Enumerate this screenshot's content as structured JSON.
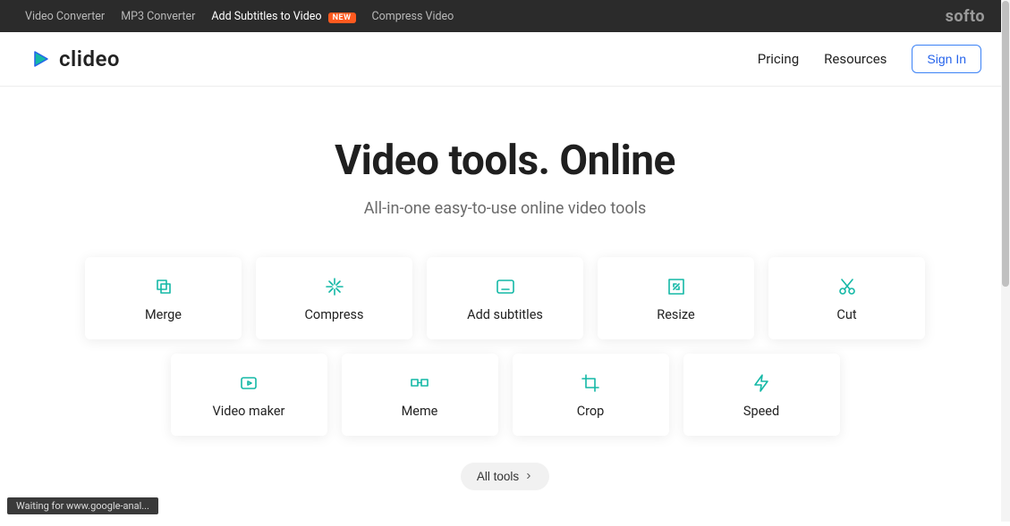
{
  "topbar": {
    "items": [
      {
        "label": "Video Converter",
        "active": false,
        "new": false
      },
      {
        "label": "MP3 Converter",
        "active": false,
        "new": false
      },
      {
        "label": "Add Subtitles to Video",
        "active": true,
        "new": true,
        "badge": "NEW"
      },
      {
        "label": "Compress Video",
        "active": false,
        "new": false
      }
    ],
    "brand_right": "softo"
  },
  "header": {
    "logo_text": "clideo",
    "nav": {
      "pricing": "Pricing",
      "resources": "Resources",
      "signin": "Sign In"
    }
  },
  "hero": {
    "title": "Video tools. Online",
    "subtitle": "All-in-one easy-to-use online video tools"
  },
  "tools_row1": [
    {
      "id": "merge",
      "label": "Merge"
    },
    {
      "id": "compress",
      "label": "Compress"
    },
    {
      "id": "subtitles",
      "label": "Add subtitles"
    },
    {
      "id": "resize",
      "label": "Resize"
    },
    {
      "id": "cut",
      "label": "Cut"
    }
  ],
  "tools_row2": [
    {
      "id": "videomaker",
      "label": "Video maker"
    },
    {
      "id": "meme",
      "label": "Meme"
    },
    {
      "id": "crop",
      "label": "Crop"
    },
    {
      "id": "speed",
      "label": "Speed"
    }
  ],
  "all_tools_label": "All tools",
  "status_text": "Waiting for www.google-anal...",
  "colors": {
    "accent": "#14b8a6",
    "link": "#2563eb"
  }
}
